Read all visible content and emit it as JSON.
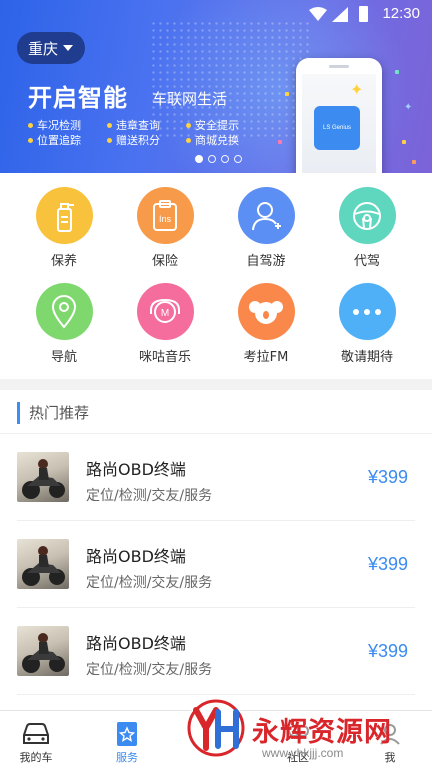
{
  "status_bar": {
    "time": "12:30"
  },
  "banner": {
    "city": "重庆",
    "headline": "开启智能",
    "subheadline": "车联网生活",
    "features": [
      "车况检测",
      "违章查询",
      "安全提示",
      "位置追踪",
      "赠送积分",
      "商城兑换"
    ],
    "device_label": "LS Genius",
    "page_count": 4,
    "active_page": 1
  },
  "services": [
    {
      "label": "保养",
      "icon": "maintenance-bottle-icon",
      "color": "#f9c23c"
    },
    {
      "label": "保险",
      "icon": "insurance-ins-icon",
      "color": "#f79a4a"
    },
    {
      "label": "自驾游",
      "icon": "self-drive-person-icon",
      "color": "#5c8ff3"
    },
    {
      "label": "代驾",
      "icon": "designated-driver-wheel-icon",
      "color": "#5fd6be"
    },
    {
      "label": "导航",
      "icon": "navigation-pin-icon",
      "color": "#7fd86e"
    },
    {
      "label": "咪咕音乐",
      "icon": "migu-music-icon",
      "color": "#f56d9c"
    },
    {
      "label": "考拉FM",
      "icon": "koala-fm-icon",
      "color": "#f9884a"
    },
    {
      "label": "敬请期待",
      "icon": "more-dots-icon",
      "color": "#4fb0f8"
    }
  ],
  "hot": {
    "title": "热门推荐",
    "items": [
      {
        "name": "路尚OBD终端",
        "desc": "定位/检测/交友/服务",
        "price": "¥399"
      },
      {
        "name": "路尚OBD终端",
        "desc": "定位/检测/交友/服务",
        "price": "¥399"
      },
      {
        "name": "路尚OBD终端",
        "desc": "定位/检测/交友/服务",
        "price": "¥399"
      }
    ]
  },
  "nav": {
    "items": [
      {
        "label": "我的车",
        "icon": "car-icon",
        "active": false
      },
      {
        "label": "服务",
        "icon": "service-star-icon",
        "active": true
      },
      {
        "label": "社区",
        "icon": "community-icon",
        "active": false
      },
      {
        "label": "我",
        "icon": "profile-icon",
        "active": false
      }
    ]
  },
  "watermark": {
    "text": "永辉资源网",
    "url": "www.yhkjjj.com"
  },
  "colors": {
    "accent": "#3b8bf0",
    "banner_start": "#2d63e8",
    "banner_end": "#7c63d8",
    "watermark_red": "#d8262b"
  }
}
